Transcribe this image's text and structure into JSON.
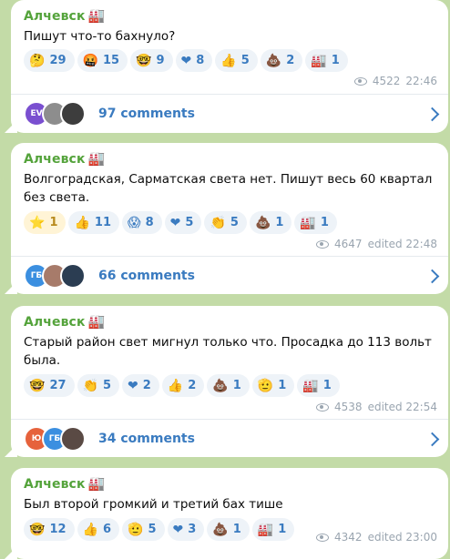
{
  "channel_name": "Алчевск",
  "channel_emoji": "🏭",
  "posts": [
    {
      "text": "Пишут что-то бахнуло?",
      "reactions": [
        {
          "emoji": "🤔",
          "count": "29",
          "icon": "thinking-face-icon"
        },
        {
          "emoji": "🤬",
          "count": "15",
          "icon": "angry-face-icon"
        },
        {
          "emoji": "🤓",
          "count": "9",
          "icon": "nerd-face-icon"
        },
        {
          "emoji": "❤",
          "count": "8",
          "icon": "heart-icon"
        },
        {
          "emoji": "👍",
          "count": "5",
          "icon": "thumbs-up-icon"
        },
        {
          "emoji": "💩",
          "count": "2",
          "icon": "poop-icon"
        },
        {
          "emoji": "🏭",
          "count": "1",
          "icon": "factory-icon"
        }
      ],
      "views": "4522",
      "time": "22:46",
      "avatars": [
        {
          "initials": "EV",
          "color": "#7a4fd0"
        },
        {
          "initials": "",
          "color": "#8d8d8d"
        },
        {
          "initials": "",
          "color": "#3d3d3d"
        }
      ],
      "comments": "97 comments"
    },
    {
      "text": "Волгоградская, Сарматская света нет. Пишут весь 60 квартал без света.",
      "reactions": [
        {
          "emoji": "⭐",
          "count": "1",
          "icon": "star-icon",
          "active": true
        },
        {
          "emoji": "👍",
          "count": "11",
          "icon": "thumbs-up-icon"
        },
        {
          "emoji": "😱",
          "count": "8",
          "icon": "screaming-face-icon"
        },
        {
          "emoji": "❤",
          "count": "5",
          "icon": "heart-icon"
        },
        {
          "emoji": "👏",
          "count": "5",
          "icon": "clapping-hands-icon"
        },
        {
          "emoji": "💩",
          "count": "1",
          "icon": "poop-icon"
        },
        {
          "emoji": "🏭",
          "count": "1",
          "icon": "factory-icon"
        }
      ],
      "views": "4647",
      "time": "edited 22:48",
      "avatars": [
        {
          "initials": "ГБ",
          "color": "#3b8fe0"
        },
        {
          "initials": "",
          "color": "#a77b6a"
        },
        {
          "initials": "",
          "color": "#2b3d52"
        }
      ],
      "comments": "66 comments"
    },
    {
      "text": "Старый район свет мигнул только что. Просадка до 113 вольт была.",
      "reactions": [
        {
          "emoji": "🤓",
          "count": "27",
          "icon": "nerd-face-icon"
        },
        {
          "emoji": "👏",
          "count": "5",
          "icon": "clapping-hands-icon"
        },
        {
          "emoji": "❤",
          "count": "2",
          "icon": "heart-icon"
        },
        {
          "emoji": "👍",
          "count": "2",
          "icon": "thumbs-up-icon"
        },
        {
          "emoji": "💩",
          "count": "1",
          "icon": "poop-icon"
        },
        {
          "emoji": "🫡",
          "count": "1",
          "icon": "saluting-face-icon"
        },
        {
          "emoji": "🏭",
          "count": "1",
          "icon": "factory-icon"
        }
      ],
      "views": "4538",
      "time": "edited 22:54",
      "avatars": [
        {
          "initials": "Ю",
          "color": "#e6623c"
        },
        {
          "initials": "ГБ",
          "color": "#3b8fe0"
        },
        {
          "initials": "",
          "color": "#5a4a44"
        }
      ],
      "comments": "34 comments"
    },
    {
      "text": "Был второй громкий и третий бах тише",
      "reactions": [
        {
          "emoji": "🤓",
          "count": "12",
          "icon": "nerd-face-icon"
        },
        {
          "emoji": "👍",
          "count": "6",
          "icon": "thumbs-up-icon"
        },
        {
          "emoji": "🫡",
          "count": "5",
          "icon": "saluting-face-icon"
        },
        {
          "emoji": "❤",
          "count": "3",
          "icon": "heart-icon"
        },
        {
          "emoji": "💩",
          "count": "1",
          "icon": "poop-icon"
        },
        {
          "emoji": "🏭",
          "count": "1",
          "icon": "factory-icon"
        }
      ],
      "views": "4342",
      "time": "edited 23:00"
    }
  ]
}
